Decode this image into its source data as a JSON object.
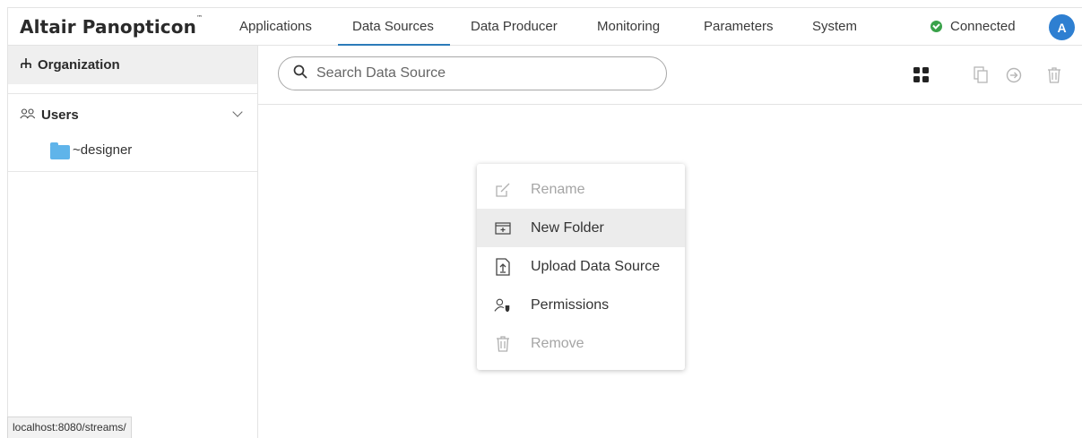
{
  "app": {
    "logo": "Altair Panopticon",
    "logo_tm": "™"
  },
  "nav": {
    "tabs": [
      {
        "label": "Applications",
        "active": false
      },
      {
        "label": "Data Sources",
        "active": true
      },
      {
        "label": "Data Producer",
        "active": false
      },
      {
        "label": "Monitoring",
        "active": false
      },
      {
        "label": "Parameters",
        "active": false
      },
      {
        "label": "System",
        "active": false
      }
    ]
  },
  "status": {
    "label": "Connected",
    "color": "#3aa24a"
  },
  "user": {
    "avatar_letter": "A",
    "avatar_color": "#2e7fd1"
  },
  "sidebar": {
    "organization_label": "Organization",
    "users_label": "Users",
    "folders": [
      {
        "label": "~designer"
      }
    ]
  },
  "search": {
    "placeholder": "Search Data Source",
    "value": ""
  },
  "context_menu": {
    "items": [
      {
        "label": "Rename",
        "icon": "rename-icon",
        "disabled": true
      },
      {
        "label": "New Folder",
        "icon": "new-folder-icon",
        "disabled": false,
        "hovered": true
      },
      {
        "label": "Upload Data Source",
        "icon": "upload-icon",
        "disabled": false
      },
      {
        "label": "Permissions",
        "icon": "permissions-icon",
        "disabled": false
      },
      {
        "label": "Remove",
        "icon": "trash-icon",
        "disabled": true
      }
    ]
  },
  "statusbar": {
    "url": "localhost:8080/streams/"
  },
  "colors": {
    "accent": "#2b7bb9",
    "folder": "#5fb4ea"
  }
}
